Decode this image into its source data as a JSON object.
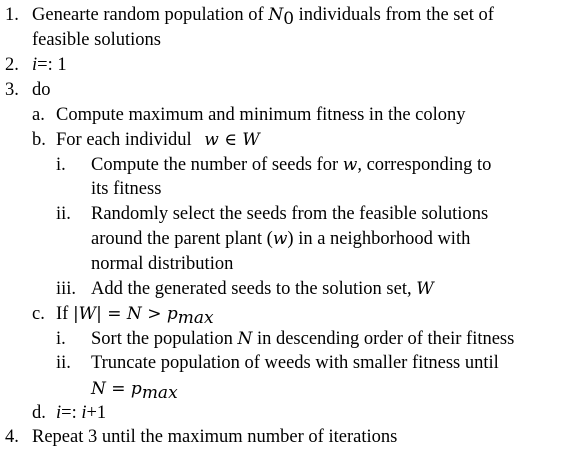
{
  "algorithm": {
    "step1": {
      "number": "1.",
      "text_a": "Genearte random population of ",
      "var": "N",
      "sub": "0",
      "text_b": " individuals from the set of",
      "cont": "feasible solutions"
    },
    "step2": {
      "number": "2.",
      "var": "i",
      "text": "=: 1"
    },
    "step3": {
      "number": "3.",
      "text": "do",
      "a": {
        "number": "a.",
        "text": "Compute maximum and minimum fitness in the colony"
      },
      "b": {
        "number": "b.",
        "text": "For each individul ",
        "math_w": "w",
        "math_in": " ∈ ",
        "math_W": "W",
        "i": {
          "number": "i.",
          "text_a": "Compute the number of seeds for ",
          "math": "w",
          "text_b": ", corresponding to",
          "cont": "its fitness"
        },
        "ii": {
          "number": "ii.",
          "text": "Randomly select the seeds from the feasible solutions",
          "cont1_a": "around the parent plant (",
          "cont1_math": "w",
          "cont1_b": ") in a neighborhood with",
          "cont2": "normal distribution"
        },
        "iii": {
          "number": "iii.",
          "text": "Add the generated seeds to the solution set, ",
          "math": "W"
        }
      },
      "c": {
        "number": "c.",
        "text": "If ",
        "math_a": "|W| = N > p",
        "math_sub": "max",
        "i": {
          "number": "i.",
          "text_a": "Sort the population ",
          "math": "N",
          "text_b": " in descending order of their fitness"
        },
        "ii": {
          "number": "ii.",
          "text": "Truncate population of weeds with smaller fitness until",
          "cont_math": "N = p",
          "cont_sub": "max"
        }
      },
      "d": {
        "number": "d.",
        "var": "i",
        "text_a": "=: ",
        "var2": "i",
        "text_b": "+1"
      }
    },
    "step4": {
      "number": "4.",
      "text": "Repeat 3 until the maximum number of iterations"
    }
  }
}
